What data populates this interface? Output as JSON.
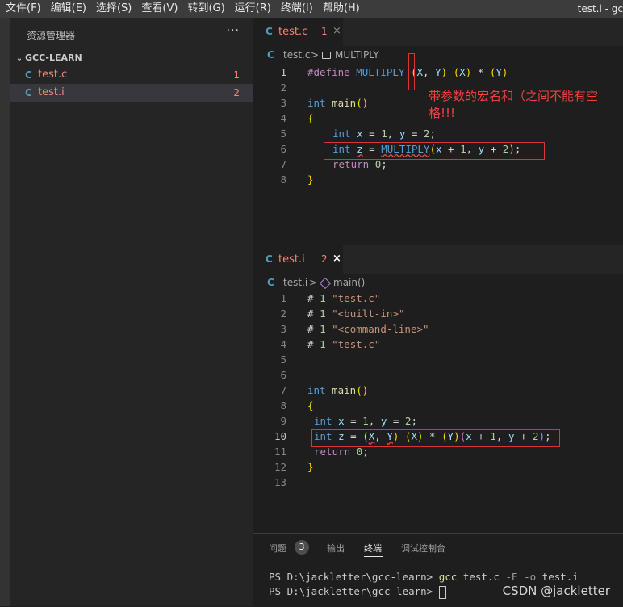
{
  "menu": [
    "文件(F)",
    "编辑(E)",
    "选择(S)",
    "查看(V)",
    "转到(G)",
    "运行(R)",
    "终端(I)",
    "帮助(H)"
  ],
  "window_title": "test.i - gc",
  "sidebar": {
    "title": "资源管理器",
    "more": "···",
    "folder": "GCC-LEARN",
    "files": [
      {
        "icon": "C",
        "name": "test.c",
        "badge": "1"
      },
      {
        "icon": "C",
        "name": "test.i",
        "badge": "2"
      }
    ]
  },
  "editor_top": {
    "tab": {
      "icon": "C",
      "name": "test.c",
      "count": "1",
      "close": "×"
    },
    "breadcrumb": {
      "file": "test.c",
      "sep": ">",
      "symbol": "MULTIPLY"
    },
    "line_numbers": [
      "1",
      "2",
      "3",
      "4",
      "5",
      "6",
      "7",
      "8"
    ],
    "code": {
      "l1_define": "#define",
      "l1_macro": "MULTIPLY",
      "l1_p1": "(",
      "l1_x": "X",
      "l1_comma": ", ",
      "l1_y": "Y",
      "l1_p2": ")",
      "l1_rest1": " ",
      "l1_p3": "(",
      "l1_x2": "X",
      "l1_p4": ")",
      "l1_mul": " * ",
      "l1_p5": "(",
      "l1_y2": "Y",
      "l1_p6": ")",
      "l3_int": "int",
      "l3_main": "main",
      "l3_parens": "()",
      "l4_brace": "{",
      "l5_int": "int",
      "l5_x": "x",
      "l5_eq1": " = ",
      "l5_one": "1",
      "l5_c": ", ",
      "l5_y": "y",
      "l5_eq2": " = ",
      "l5_two": "2",
      "l5_semi": ";",
      "l6_int": "int",
      "l6_z": "z",
      "l6_eq": " = ",
      "l6_mac": "MULTIPLY",
      "l6_open": "(",
      "l6_x": "x",
      "l6_plus1": " + ",
      "l6_one": "1",
      "l6_c": ", ",
      "l6_y": "y",
      "l6_plus2": " + ",
      "l6_two": "2",
      "l6_close": ")",
      "l6_semi": ";",
      "l7_return": "return",
      "l7_zero": "0",
      "l7_semi": ";",
      "l8_brace": "}"
    },
    "annotation": [
      "带参数的宏名和（之间不能有空",
      "格!!!"
    ]
  },
  "editor_bottom": {
    "tab": {
      "icon": "C",
      "name": "test.i",
      "count": "2",
      "close": "×"
    },
    "breadcrumb": {
      "file": "test.i",
      "sep": ">",
      "symbol": "main()"
    },
    "line_numbers": [
      "1",
      "2",
      "3",
      "4",
      "5",
      "6",
      "7",
      "8",
      "9",
      "10",
      "11",
      "12",
      "13"
    ],
    "code": {
      "l1_hash": "# ",
      "l1_n": "1",
      "l1_s": "\"test.c\"",
      "l2_hash": "# ",
      "l2_n": "1",
      "l2_s": "\"<built-in>\"",
      "l3_hash": "# ",
      "l3_n": "1",
      "l3_s": "\"<command-line>\"",
      "l4_hash": "# ",
      "l4_n": "1",
      "l4_s": "\"test.c\"",
      "l7_int": "int",
      "l7_main": "main",
      "l7_parens": "()",
      "l8_brace": "{",
      "l9_int": "int",
      "l9_x": "x",
      "l9_eq1": " = ",
      "l9_one": "1",
      "l9_c": ", ",
      "l9_y": "y",
      "l9_eq2": " = ",
      "l9_two": "2",
      "l9_semi": ";",
      "l10_int": "int",
      "l10_z": "z",
      "l10_eq": " = ",
      "l10_p1": "(",
      "l10_X": "X",
      "l10_c1": ", ",
      "l10_Y": "Y",
      "l10_p2": ")",
      "l10_sp": " ",
      "l10_p3": "(",
      "l10_X2": "X",
      "l10_p4": ")",
      "l10_mul": " * ",
      "l10_p5": "(",
      "l10_Y2": "Y",
      "l10_p6": ")",
      "l10_p7": "(",
      "l10_x": "x",
      "l10_plus1": " + ",
      "l10_one": "1",
      "l10_c2": ", ",
      "l10_y": "y",
      "l10_plus2": " + ",
      "l10_two": "2",
      "l10_p8": ")",
      "l10_semi": ";",
      "l11_return": "return",
      "l11_zero": "0",
      "l11_semi": ";",
      "l12_brace": "}"
    }
  },
  "panel": {
    "tabs": [
      "问题",
      "输出",
      "终端",
      "调试控制台"
    ],
    "problems_count": "3",
    "terminal": {
      "prompt": "PS D:\\jackletter\\gcc-learn> ",
      "cmd": "gcc",
      "args1": " test.c ",
      "flags": "-E -o",
      "args2": " test.i"
    }
  },
  "watermark": "CSDN @jackletter",
  "colors": {
    "error": "#f48771",
    "annotation_red": "#e0303a"
  }
}
